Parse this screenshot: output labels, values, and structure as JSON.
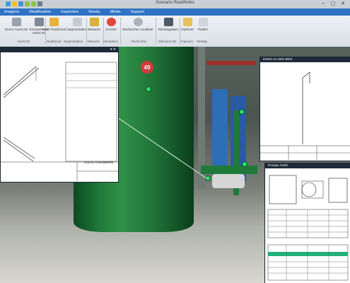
{
  "app": {
    "title": "Scenario RealWorks"
  },
  "menu": [
    "Imagerie",
    "Modélisation",
    "Inspection",
    "Rendu",
    "Média",
    "Support"
  ],
  "ribbon": {
    "buttons": [
      {
        "label": "Ouvrir AutoCAD",
        "icon": "autocad-open-icon"
      },
      {
        "label": "Envoyer vers AutoCAD",
        "icon": "send-to-autocad-icon"
      },
      {
        "label": "Ouvrir RealCloud",
        "icon": "realcloud-open-icon"
      },
      {
        "label": "Segmentation",
        "icon": "segmentation-icon"
      },
      {
        "label": "Mesures",
        "icon": "measure-icon"
      },
      {
        "label": "Annoter",
        "icon": "annotate-icon"
      },
      {
        "label": "Rechercher Localiser",
        "icon": "search-locate-icon"
      },
      {
        "label": "Rectangulaire",
        "icon": "rectangle-select-icon"
      },
      {
        "label": "Imprimer",
        "icon": "print-icon"
      },
      {
        "label": "Publier",
        "icon": "publish-icon"
      }
    ],
    "groups": [
      "AutoCAD",
      "RealCloud",
      "Segmentation",
      "Mesures",
      "Annotation",
      "Recherche",
      "Sélection 3D",
      "Imprimer",
      "Partage"
    ]
  },
  "viewport": {
    "badge": "49",
    "colors": {
      "tank": "#1f7a39",
      "pin": "#27e06a",
      "badge": "#d23a3a"
    }
  },
  "panels": {
    "left": {
      "title_block": "LOCAL CHAUDIERE"
    },
    "right_top": {
      "title": "DN40-AA-002-IN01"
    },
    "right_bottom": {
      "title": "Pompe AS40"
    }
  }
}
